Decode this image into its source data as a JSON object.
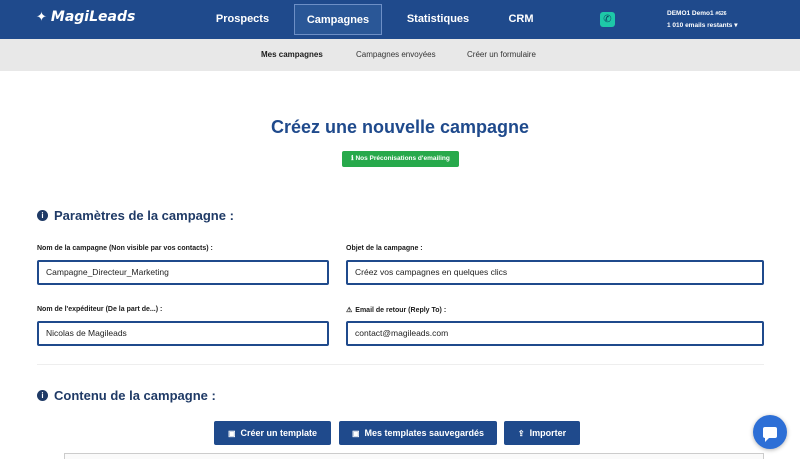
{
  "brand": {
    "name": "MagiLeads",
    "icon": "magic-wand-icon"
  },
  "nav": {
    "items": [
      {
        "label": "Prospects",
        "active": false
      },
      {
        "label": "Campagnes",
        "active": true
      },
      {
        "label": "Statistiques",
        "active": false
      },
      {
        "label": "CRM",
        "active": false
      }
    ],
    "phone_icon": "phone-icon"
  },
  "account": {
    "name": "DEMO1 Demo1",
    "id": "#626",
    "emails_remaining": "1 010 emails restants"
  },
  "subnav": {
    "items": [
      {
        "label": "Mes campagnes",
        "active": true
      },
      {
        "label": "Campagnes envoyées",
        "active": false
      },
      {
        "label": "Créer un formulaire",
        "active": false
      }
    ]
  },
  "main": {
    "title": "Créez une nouvelle campagne",
    "recommendations_badge": "ℹ Nos Préconisations d'emailing"
  },
  "params_section": {
    "title": "Paramètres de la campagne :",
    "fields": {
      "campaign_name": {
        "label": "Nom de la campagne (Non visible par vos contacts) :",
        "value": "Campagne_Directeur_Marketing"
      },
      "subject": {
        "label": "Objet de la campagne :",
        "value": "Créez vos campagnes en quelques clics"
      },
      "sender": {
        "label": "Nom de l'expéditeur (De la part de...) :",
        "value": "Nicolas de Magileads"
      },
      "reply_to": {
        "label": "Email de retour (Reply To) :",
        "value": "contact@magileads.com"
      }
    }
  },
  "content_section": {
    "title": "Contenu de la campagne :",
    "buttons": {
      "create_template": "Créer un template",
      "saved_templates": "Mes templates sauvegardés",
      "import": "Importer"
    }
  },
  "colors": {
    "primary": "#1f4a8c",
    "success": "#27a94b",
    "subnav_bg": "#e8e8e8",
    "chat": "#2d6fd6"
  }
}
